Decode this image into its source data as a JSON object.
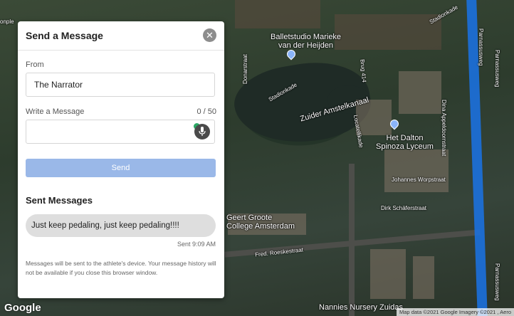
{
  "map": {
    "labels": {
      "balletstudio": "Balletstudio Marieke\nvan der Heijden",
      "stadionkade_top": "Stadionkade",
      "stadionkade_mid": "Stadionkade",
      "donarstraat": "Donarstraat",
      "zuider": "Zuider Amstelkanaal",
      "brug": "Brug 414",
      "locatellikade": "Locatellikade",
      "dalton": "Het Dalton\nSpinoza Lyceum",
      "dina": "Dina Appeldoornstraat",
      "johannes": "Johannes Worpstraat",
      "dirk": "Dirk Schäferstraat",
      "geert": "Geert Groote\nCollege Amsterdam",
      "fred": "Fred. Roeskestraat",
      "nannies": "Nannies Nursery Zuidas",
      "parnassusweg_1": "Parnassusweg",
      "parnassusweg_2": "Parnassusweg",
      "parnassusweg_3": "Parnassusweg",
      "left_partial": "onple"
    },
    "google_logo": "Google",
    "attribution": "Map data ©2021 Google Imagery ©2021 , Aero",
    "route_color": "#1a73e8"
  },
  "panel": {
    "title": "Send a Message",
    "close_symbol": "✕",
    "from_label": "From",
    "from_value": "The Narrator",
    "message_label": "Write a Message",
    "counter": "0 / 50",
    "message_value": "",
    "send_label": "Send",
    "send_color": "#9ab8e8",
    "sent_title": "Sent Messages",
    "sent_messages": [
      {
        "text": "Just keep pedaling, just keep pedaling!!!!",
        "time": "Sent 9:09 AM"
      }
    ],
    "note": "Messages will be sent to the athlete's device. Your message history will not be available if you close this browser window."
  }
}
